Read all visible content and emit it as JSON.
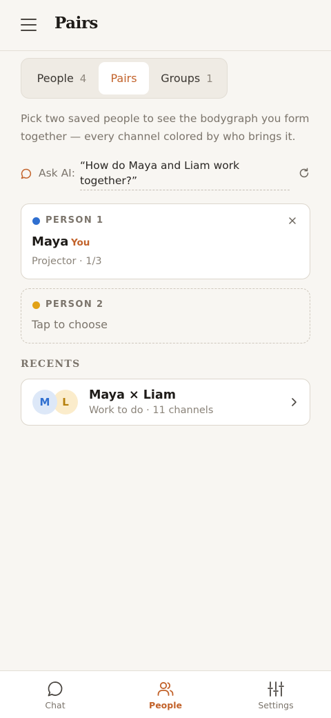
{
  "header": {
    "title": "Pairs",
    "menu_icon": "hamburger-menu-icon"
  },
  "tabs": [
    {
      "label": "People",
      "count": "4"
    },
    {
      "label": "Pairs",
      "count": ""
    },
    {
      "label": "Groups",
      "count": "1"
    }
  ],
  "active_tab": "Pairs",
  "intro": "Pick two saved people to see the bodygraph you form together — every channel colored by who brings it.",
  "ask_ai": {
    "label": "Ask AI:",
    "question": "“How do Maya and Liam work together?”",
    "icon": "chat-bubble-icon",
    "refresh_icon": "refresh-icon"
  },
  "person1": {
    "label": "PERSON 1",
    "name": "Maya",
    "tag": "You",
    "meta": "Projector · 1/3",
    "dot_color": "#2f6fd0"
  },
  "person2": {
    "label": "PERSON 2",
    "placeholder": "Tap to choose",
    "dot_color": "#e2a217"
  },
  "recents": {
    "heading": "RECENTS",
    "items": [
      {
        "avatars": [
          "M",
          "L"
        ],
        "title": "Maya × Liam",
        "subtitle": "Work to do · 11 channels"
      }
    ]
  },
  "bottom_nav": [
    {
      "label": "Chat",
      "icon": "chat-icon"
    },
    {
      "label": "People",
      "icon": "people-icon"
    },
    {
      "label": "Settings",
      "icon": "sliders-icon"
    }
  ],
  "colors": {
    "accent": "#c2622a",
    "background": "#f8f6f2"
  }
}
